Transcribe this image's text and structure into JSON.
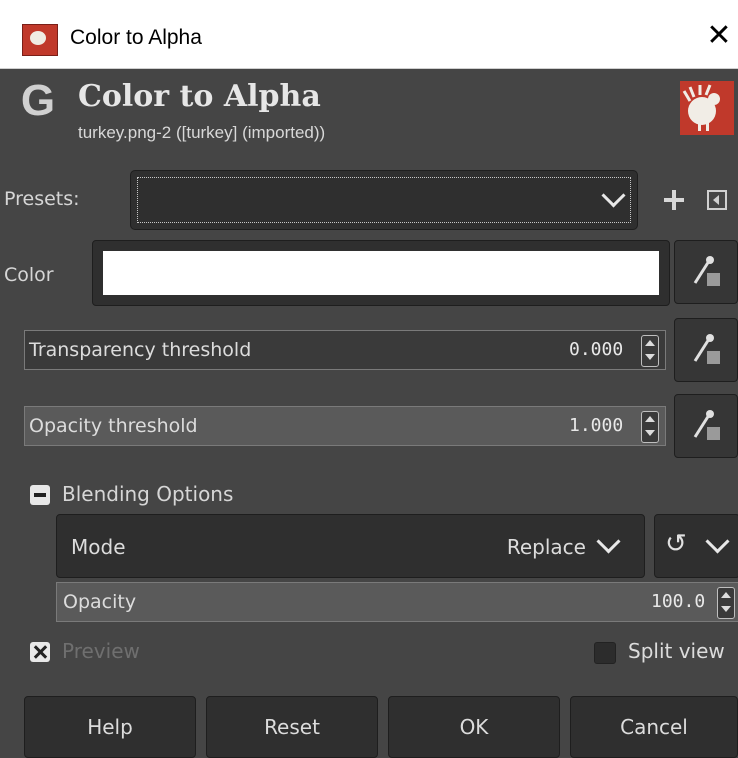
{
  "window": {
    "title": "Color to Alpha",
    "close_glyph": "✕"
  },
  "header": {
    "logo_letter": "G",
    "title": "Color to Alpha",
    "subtitle": "turkey.png-2 ([turkey] (imported))"
  },
  "presets": {
    "label": "Presets:",
    "value": ""
  },
  "color": {
    "label": "Color",
    "value_hex": "#ffffff"
  },
  "transparency": {
    "label": "Transparency threshold",
    "value": "0.000",
    "fraction": 0.0
  },
  "opacity_threshold": {
    "label": "Opacity threshold",
    "value": "1.000",
    "fraction": 1.0
  },
  "blending": {
    "label": "Blending Options",
    "mode_label": "Mode",
    "mode_value": "Replace",
    "composite_symbol": "↺",
    "opacity_label": "Opacity",
    "opacity_value": "100.0",
    "opacity_fraction": 1.0
  },
  "preview": {
    "label": "Preview",
    "checked": true
  },
  "split_view": {
    "label": "Split view",
    "checked": false
  },
  "buttons": {
    "help": "Help",
    "reset": "Reset",
    "ok": "OK",
    "cancel": "Cancel"
  },
  "colors": {
    "background": "#454545",
    "field": "#2f2f2f",
    "accent": "#c0392b"
  }
}
